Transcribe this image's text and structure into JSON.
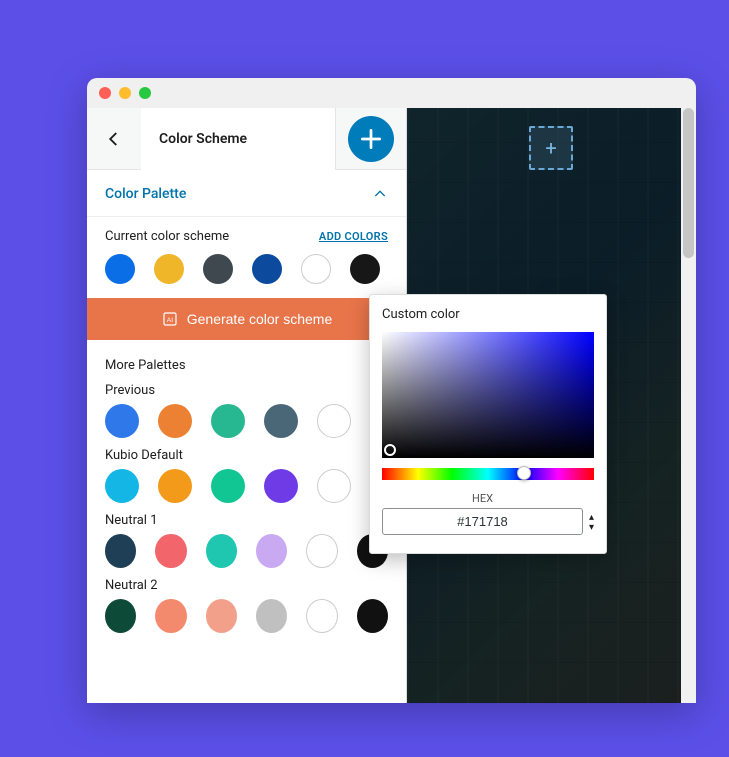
{
  "window": {
    "title": "Color Scheme"
  },
  "section": {
    "title": "Color Palette"
  },
  "current": {
    "label": "Current color scheme",
    "add_colors": "ADD COLORS",
    "swatches": [
      "#0a6fe6",
      "#f0b62a",
      "#3f474f",
      "#0c4a9e",
      "#ffffff",
      "#171718"
    ]
  },
  "generate": {
    "label": "Generate color scheme"
  },
  "more": {
    "label": "More Palettes",
    "palettes": [
      {
        "name": "Previous",
        "swatches": [
          "#2f78ea",
          "#ec8133",
          "#28b891",
          "#4a6778",
          "#ffffff"
        ]
      },
      {
        "name": "Kubio Default",
        "swatches": [
          "#14b6e6",
          "#f39a1a",
          "#12c694",
          "#6f3be6",
          "#ffffff"
        ]
      },
      {
        "name": "Neutral 1",
        "swatches": [
          "#1e3f55",
          "#f2656a",
          "#1fc7b1",
          "#c9a9f2",
          "#ffffff",
          "#111111"
        ]
      },
      {
        "name": "Neutral 2",
        "swatches": [
          "#0d4a37",
          "#f3896d",
          "#f3a08a",
          "#c0c0c0",
          "#ffffff",
          "#111111"
        ]
      }
    ]
  },
  "picker": {
    "title": "Custom color",
    "hex_label": "HEX",
    "hex_value": "#171718"
  },
  "icons": {
    "plus": "+",
    "chevron_up": "up"
  }
}
